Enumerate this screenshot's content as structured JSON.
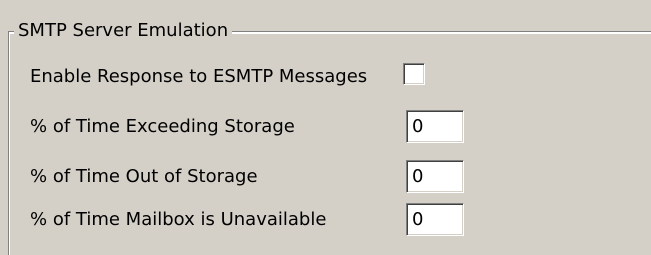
{
  "group": {
    "title": "SMTP Server Emulation"
  },
  "fields": {
    "esmtp": {
      "label": "Enable Response to ESMTP Messages",
      "checked": false
    },
    "exceeding_storage": {
      "label": "% of Time Exceeding Storage",
      "value": "0"
    },
    "out_of_storage": {
      "label": "% of Time Out of Storage",
      "value": "0"
    },
    "mailbox_unavailable": {
      "label": "% of Time Mailbox is Unavailable",
      "value": "0"
    }
  }
}
